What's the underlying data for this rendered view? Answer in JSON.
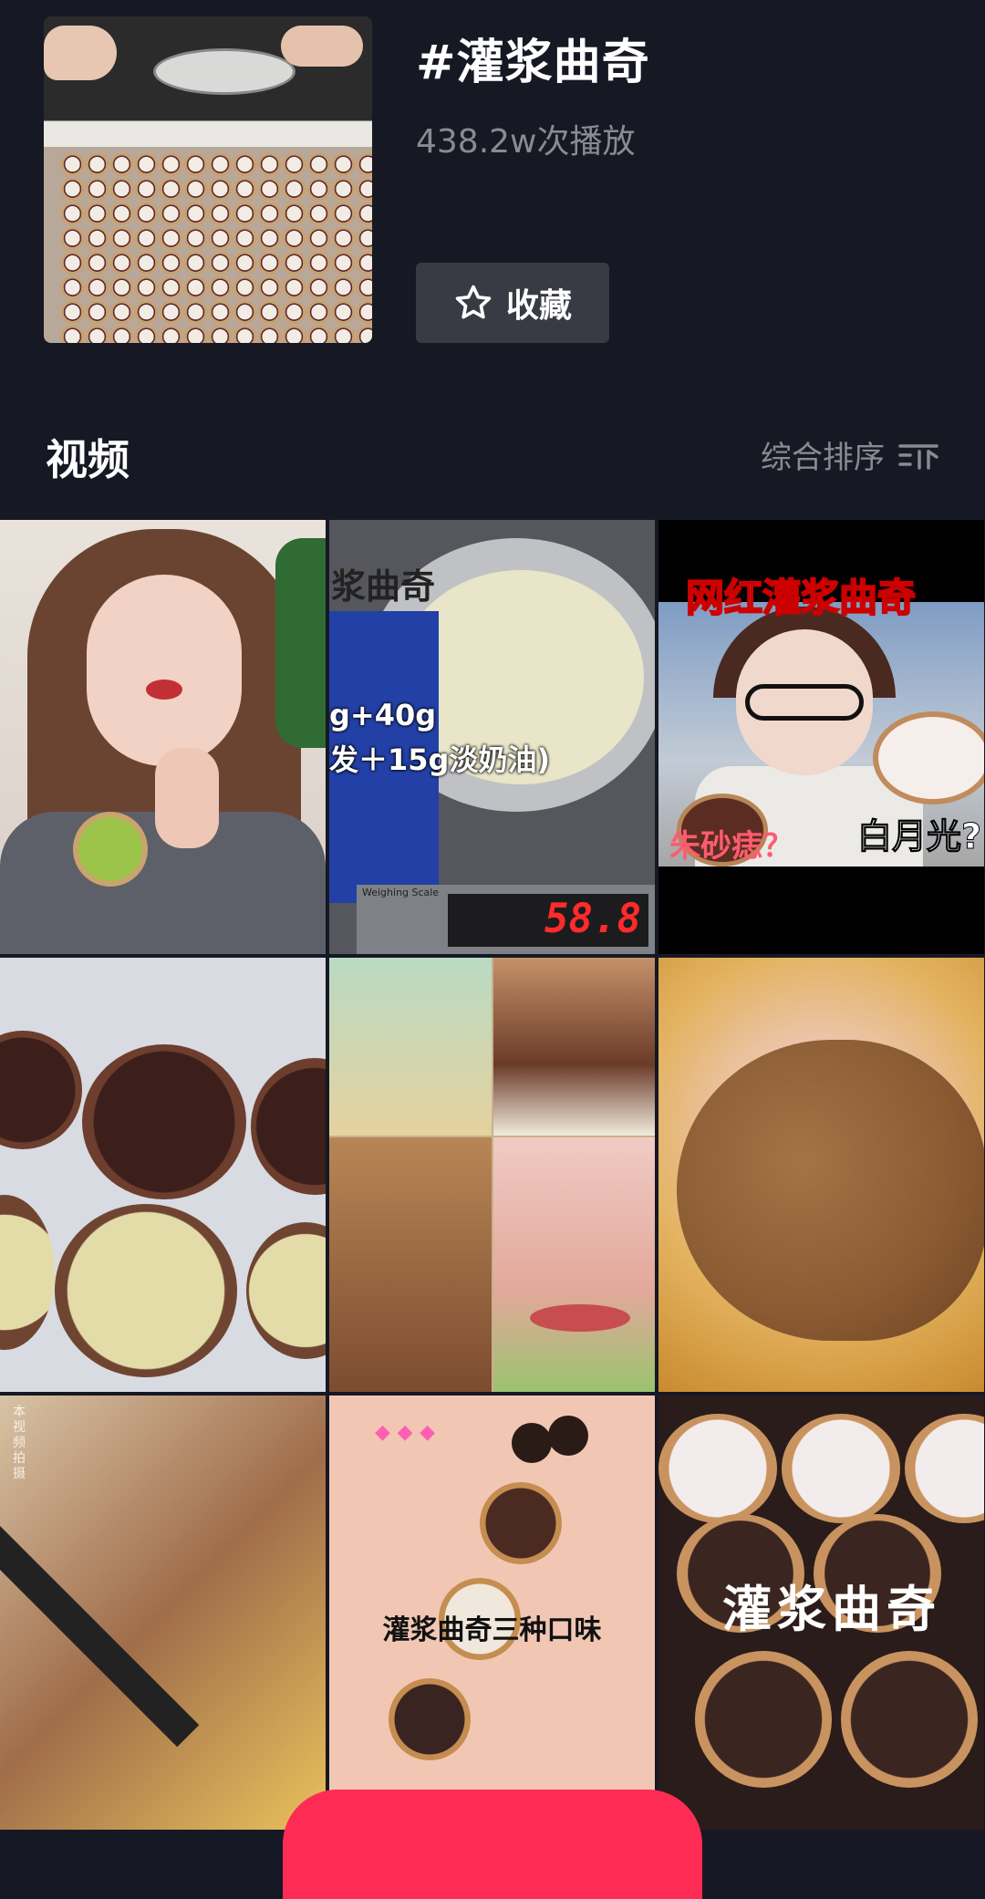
{
  "header": {
    "tag_title": "#灌浆曲奇",
    "play_count": "438.2w次播放",
    "favorite_label": "收藏"
  },
  "section": {
    "title": "视频",
    "sort_label": "综合排序"
  },
  "videos": [
    {
      "texts": []
    },
    {
      "texts": [
        "浆曲奇",
        "g+40g",
        "发＋15g淡奶油)",
        "Weighing Scale",
        "58.8"
      ]
    },
    {
      "texts": [
        "网红灌浆曲奇",
        "朱砂痣？",
        "白月光?"
      ]
    },
    {
      "texts": []
    },
    {
      "texts": []
    },
    {
      "texts": []
    },
    {
      "texts": [
        "本视频拍摄"
      ]
    },
    {
      "texts": [
        "灌浆曲奇三种口味"
      ]
    },
    {
      "texts": [
        "灌浆曲奇"
      ]
    }
  ],
  "colors": {
    "background": "#161823",
    "accent": "#fe2c55",
    "muted_text": "#8a8b91",
    "button_bg": "#393b44"
  },
  "icons": {
    "favorite": "star-outline-icon",
    "sort": "sort-filter-icon"
  }
}
